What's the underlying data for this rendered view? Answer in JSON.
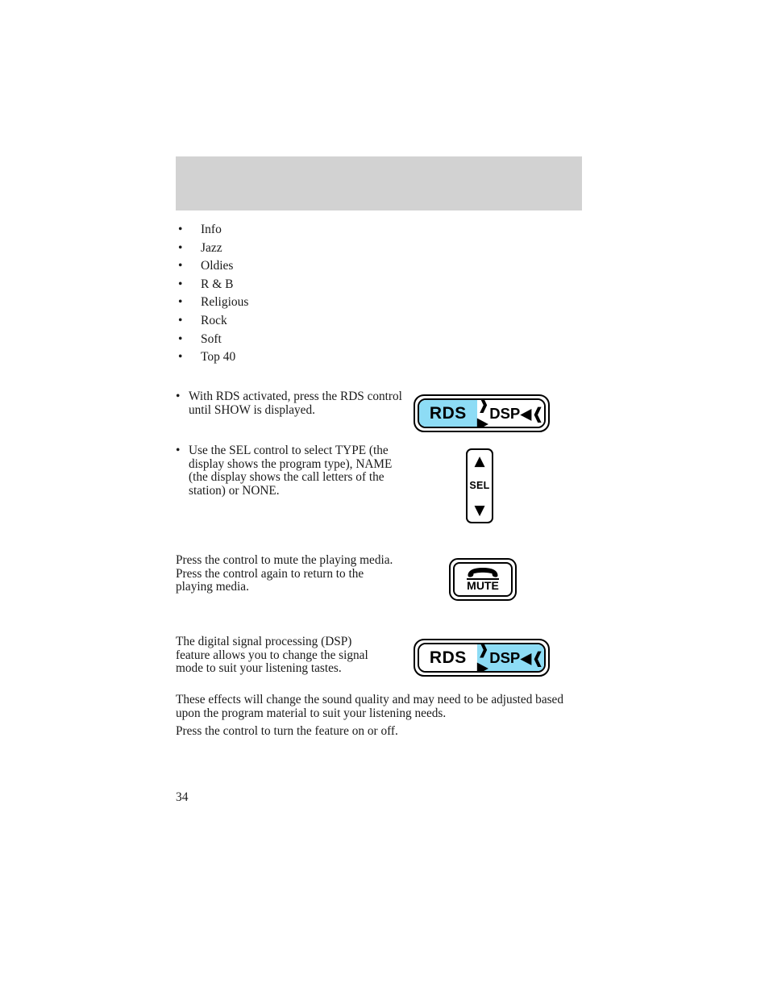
{
  "document": {
    "page_number": "34",
    "header_band": {
      "label": "",
      "color": "#d2d2d2"
    }
  },
  "genre_list": {
    "bullet_glyph": "•",
    "items": [
      {
        "label": "Info"
      },
      {
        "label": "Jazz"
      },
      {
        "label": "Oldies"
      },
      {
        "label": "R & B"
      },
      {
        "label": "Religious"
      },
      {
        "label": "Rock"
      },
      {
        "label": "Soft"
      },
      {
        "label": "Top 40"
      }
    ]
  },
  "instructions": {
    "bullet_glyph": "•",
    "items": [
      {
        "text": "With RDS activated, press the RDS control until SHOW is displayed."
      },
      {
        "text": "Use the SEL control to select TYPE (the display shows the program type), NAME (the display shows the call letters of the station) or NONE."
      }
    ]
  },
  "mute_section": {
    "paragraph": "Press the control to mute the playing media. Press the control again to return to the playing media.",
    "button": {
      "label": "MUTE",
      "icon": "phone-handset-icon"
    }
  },
  "dsp_section": {
    "paragraph_intro": "The digital signal processing (DSP) feature allows you to change the signal mode to suit your listening tastes.",
    "paragraph_effects": "These effects will change the sound quality and may need to be adjusted based upon the program material to suit your listening needs.",
    "paragraph_press": "Press the control to turn the feature on or off."
  },
  "controls": {
    "rds_dsp_button_rds_active": {
      "rds_label": "RDS",
      "dsp_label": "DSP",
      "dsp_left_arrow": "❱▶",
      "dsp_right_arrow": "◀❰",
      "active_side": "RDS",
      "highlight_color": "#8ddcf5"
    },
    "rds_dsp_button_dsp_active": {
      "rds_label": "RDS",
      "dsp_label": "DSP",
      "dsp_left_arrow": "❱▶",
      "dsp_right_arrow": "◀❰",
      "active_side": "DSP",
      "highlight_color": "#8ddcf5"
    },
    "sel_control": {
      "up_glyph": "▲",
      "label": "SEL",
      "down_glyph": "▼"
    }
  }
}
